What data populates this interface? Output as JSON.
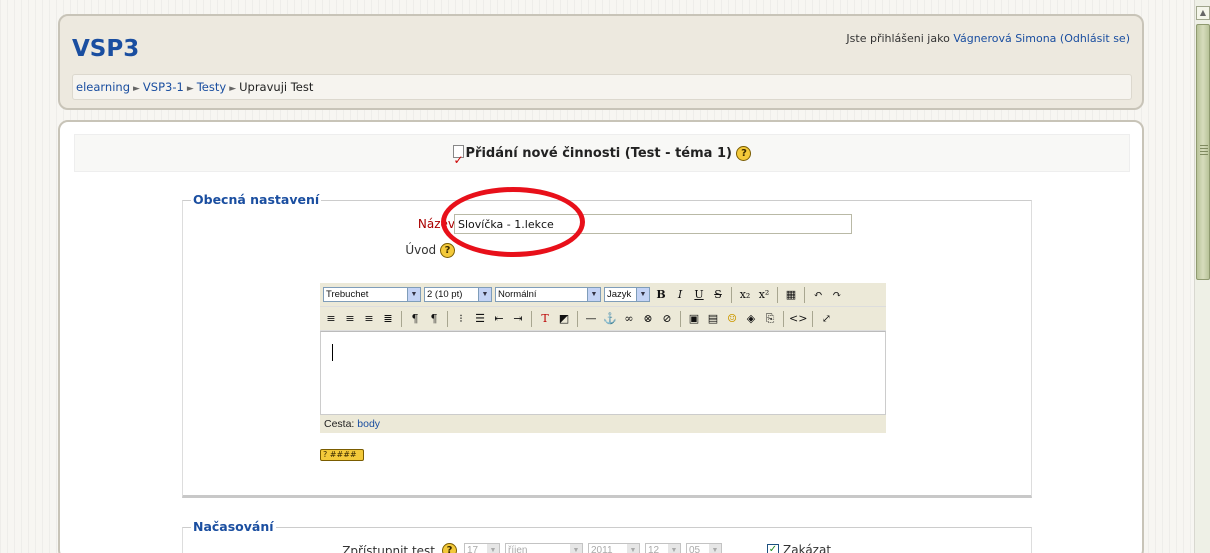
{
  "header": {
    "site_title": "VSP3",
    "login_prefix": "Jste přihlášeni jako ",
    "user_name": "Vágnerová Simona",
    "logout_label": "(Odhlásit se)"
  },
  "breadcrumb": {
    "items": [
      "elearning",
      "VSP3-1",
      "Testy",
      "Upravuji Test"
    ],
    "separator": "►"
  },
  "page": {
    "heading": "Přidání nové činnosti (Test - téma 1)",
    "help_label": "?"
  },
  "general_section": {
    "legend": "Obecná nastavení",
    "name_label": "Název",
    "name_value": "Slovíčka - 1.lekce",
    "intro_label": "Úvod"
  },
  "editor": {
    "font_family": "Trebuchet",
    "font_size": "2 (10 pt)",
    "format": "Normální",
    "language": "Jazyk",
    "path_label": "Cesta:",
    "path_value": "body",
    "help_pill_label": "? ####",
    "toolbar_row1_buttons": [
      {
        "icon": "bold-icon",
        "glyph": "B"
      },
      {
        "icon": "italic-icon",
        "glyph": "I"
      },
      {
        "icon": "underline-icon",
        "glyph": "U"
      },
      {
        "icon": "strikethrough-icon",
        "glyph": "S"
      },
      {
        "icon": "subscript-icon",
        "glyph": "x₂"
      },
      {
        "icon": "superscript-icon",
        "glyph": "x²"
      },
      {
        "icon": "paste-word-icon",
        "glyph": "▦"
      },
      {
        "icon": "undo-icon",
        "glyph": "↶"
      },
      {
        "icon": "redo-icon",
        "glyph": "↷"
      }
    ],
    "toolbar_row2_buttons": [
      {
        "icon": "align-left-icon",
        "glyph": "≡"
      },
      {
        "icon": "align-center-icon",
        "glyph": "≡"
      },
      {
        "icon": "align-right-icon",
        "glyph": "≡"
      },
      {
        "icon": "justify-icon",
        "glyph": "≣"
      },
      {
        "icon": "ltr-icon",
        "glyph": "¶"
      },
      {
        "icon": "rtl-icon",
        "glyph": "¶"
      },
      {
        "icon": "ordered-list-icon",
        "glyph": "⁝"
      },
      {
        "icon": "unordered-list-icon",
        "glyph": "☰"
      },
      {
        "icon": "outdent-icon",
        "glyph": "⇤"
      },
      {
        "icon": "indent-icon",
        "glyph": "⇥"
      },
      {
        "icon": "text-color-icon",
        "glyph": "T"
      },
      {
        "icon": "background-color-icon",
        "glyph": "◩"
      },
      {
        "icon": "horizontal-rule-icon",
        "glyph": "—"
      },
      {
        "icon": "anchor-icon",
        "glyph": "⚓"
      },
      {
        "icon": "link-icon",
        "glyph": "∞"
      },
      {
        "icon": "unlink-icon",
        "glyph": "⊗"
      },
      {
        "icon": "no-link-icon",
        "glyph": "⊘"
      },
      {
        "icon": "image-icon",
        "glyph": "▣"
      },
      {
        "icon": "table-icon",
        "glyph": "▤"
      },
      {
        "icon": "smiley-icon",
        "glyph": "☺"
      },
      {
        "icon": "special-chars-icon",
        "glyph": "◈"
      },
      {
        "icon": "search-replace-icon",
        "glyph": "⎘"
      },
      {
        "icon": "html-source-icon",
        "glyph": "<>"
      },
      {
        "icon": "fullscreen-icon",
        "glyph": "⤢"
      }
    ]
  },
  "timing_section": {
    "legend": "Načasování",
    "open_label": "Zpřístupnit test",
    "day": "17",
    "month": "říjen",
    "year": "2011",
    "hour": "12",
    "minute": "05",
    "disable_label": "Zakázat",
    "disable_checked": "✓"
  }
}
